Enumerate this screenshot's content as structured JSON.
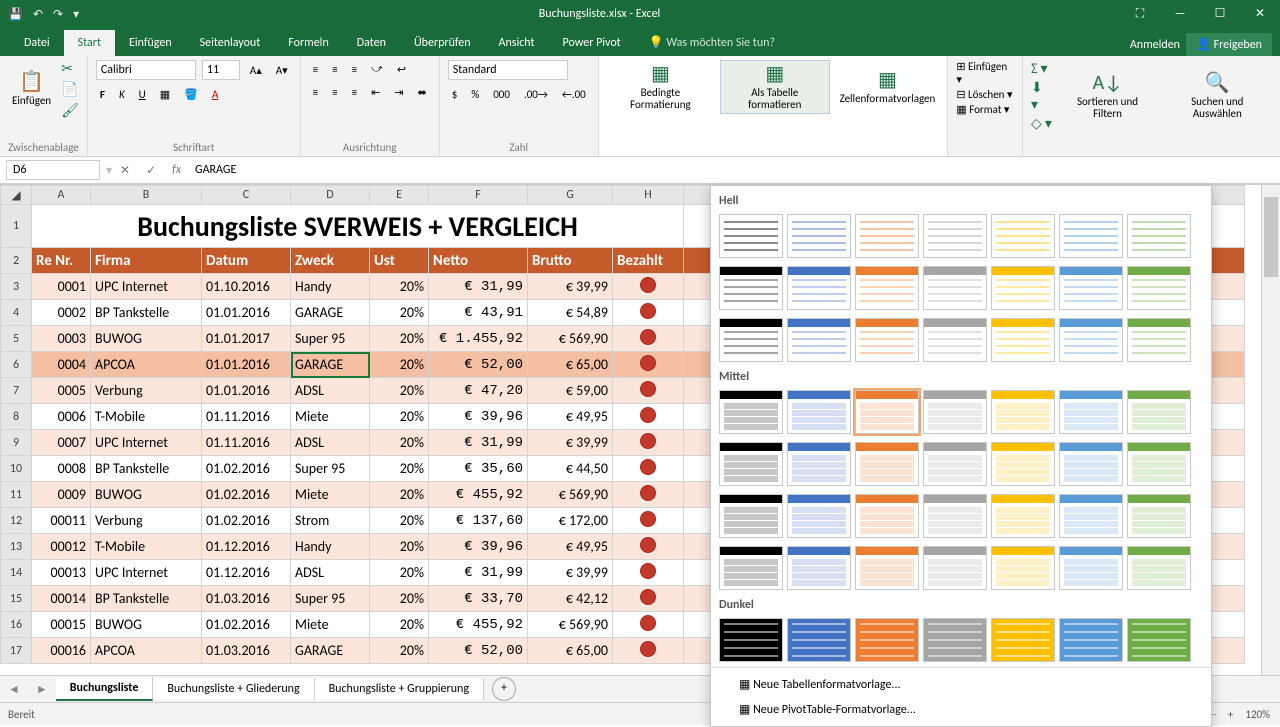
{
  "app": {
    "title": "Buchungsliste.xlsx - Excel",
    "save_icon": "💾",
    "undo": "↶",
    "redo": "↷"
  },
  "win": {
    "opts": "⛶",
    "min": "—",
    "max": "☐",
    "close": "✕"
  },
  "signin": {
    "anmelden": "Anmelden",
    "share": "Freigeben"
  },
  "tabs": {
    "datei": "Datei",
    "start": "Start",
    "einfuegen": "Einfügen",
    "seitenlayout": "Seitenlayout",
    "formeln": "Formeln",
    "daten": "Daten",
    "ueberpruefen": "Überprüfen",
    "ansicht": "Ansicht",
    "powerpivot": "Power Pivot",
    "tellme": "Was möchten Sie tun?"
  },
  "ribbon": {
    "clipboard": {
      "label": "Zwischenablage",
      "paste": "Einfügen"
    },
    "font": {
      "label": "Schriftart",
      "name": "Calibri",
      "size": "11"
    },
    "align": {
      "label": "Ausrichtung"
    },
    "number": {
      "label": "Zahl",
      "format": "Standard"
    },
    "styles": {
      "cond": "Bedingte Formatierung",
      "table": "Als Tabelle formatieren",
      "cell": "Zellenformatvorlagen"
    },
    "cells": {
      "insert": "Einfügen",
      "delete": "Löschen",
      "format": "Format"
    },
    "editing": {
      "sort": "Sortieren und Filtern",
      "find": "Suchen und Auswählen"
    }
  },
  "formula": {
    "cell": "D6",
    "value": "GARAGE"
  },
  "cols": [
    "A",
    "B",
    "C",
    "D",
    "E",
    "F",
    "G",
    "H"
  ],
  "worksheet_title": "Buchungsliste SVERWEIS + VERGLEICH",
  "headers": [
    "Re Nr.",
    "Firma",
    "Datum",
    "Zweck",
    "Ust",
    "Netto",
    "Brutto",
    "Bezahlt"
  ],
  "rows": [
    {
      "n": 3,
      "r": "0001",
      "f": "UPC Internet",
      "d": "01.10.2016",
      "z": "Handy",
      "u": "20%",
      "net": "€      31,99",
      "br": "€ 39,99"
    },
    {
      "n": 4,
      "r": "0002",
      "f": "BP Tankstelle",
      "d": "01.01.2016",
      "z": "GARAGE",
      "u": "20%",
      "net": "€      43,91",
      "br": "€ 54,89"
    },
    {
      "n": 5,
      "r": "0003",
      "f": "BUWOG",
      "d": "01.01.2017",
      "z": "Super 95",
      "u": "20%",
      "net": "€ 1.455,92",
      "br": "€ 569,90"
    },
    {
      "n": 6,
      "r": "0004",
      "f": "APCOA",
      "d": "01.01.2016",
      "z": "GARAGE",
      "u": "20%",
      "net": "€      52,00",
      "br": "€ 65,00",
      "sel": true,
      "hl": true
    },
    {
      "n": 7,
      "r": "0005",
      "f": "Verbung",
      "d": "01.01.2016",
      "z": "ADSL",
      "u": "20%",
      "net": "€      47,20",
      "br": "€ 59,00"
    },
    {
      "n": 8,
      "r": "0006",
      "f": "T-Mobile",
      "d": "01.11.2016",
      "z": "Miete",
      "u": "20%",
      "net": "€      39,96",
      "br": "€ 49,95"
    },
    {
      "n": 9,
      "r": "0007",
      "f": "UPC Internet",
      "d": "01.11.2016",
      "z": "ADSL",
      "u": "20%",
      "net": "€      31,99",
      "br": "€ 39,99"
    },
    {
      "n": 10,
      "r": "0008",
      "f": "BP Tankstelle",
      "d": "01.02.2016",
      "z": "Super 95",
      "u": "20%",
      "net": "€      35,60",
      "br": "€ 44,50"
    },
    {
      "n": 11,
      "r": "0009",
      "f": "BUWOG",
      "d": "01.02.2016",
      "z": "Miete",
      "u": "20%",
      "net": "€    455,92",
      "br": "€ 569,90"
    },
    {
      "n": 12,
      "r": "00011",
      "f": "Verbung",
      "d": "01.02.2016",
      "z": "Strom",
      "u": "20%",
      "net": "€    137,60",
      "br": "€ 172,00"
    },
    {
      "n": 13,
      "r": "00012",
      "f": "T-Mobile",
      "d": "01.12.2016",
      "z": "Handy",
      "u": "20%",
      "net": "€      39,96",
      "br": "€ 49,95"
    },
    {
      "n": 14,
      "r": "00013",
      "f": "UPC Internet",
      "d": "01.12.2016",
      "z": "ADSL",
      "u": "20%",
      "net": "€      31,99",
      "br": "€ 39,99"
    },
    {
      "n": 15,
      "r": "00014",
      "f": "BP Tankstelle",
      "d": "01.03.2016",
      "z": "Super 95",
      "u": "20%",
      "net": "€      33,70",
      "br": "€ 42,12"
    },
    {
      "n": 16,
      "r": "00015",
      "f": "BUWOG",
      "d": "01.02.2016",
      "z": "Miete",
      "u": "20%",
      "net": "€    455,92",
      "br": "€ 569,90"
    },
    {
      "n": 17,
      "r": "00016",
      "f": "APCOA",
      "d": "01.03.2016",
      "z": "GARAGE",
      "u": "20%",
      "net": "€      52,00",
      "br": "€ 65,00"
    }
  ],
  "gallery": {
    "hell": "Hell",
    "mittel": "Mittel",
    "dunkel": "Dunkel",
    "colors": [
      "#000000",
      "#4573c4",
      "#ed7d31",
      "#a5a5a5",
      "#ffc000",
      "#5a9bd5",
      "#70ad47"
    ],
    "new_table": "Neue Tabellenformatvorlage...",
    "new_pivot": "Neue PivotTable-Formatvorlage..."
  },
  "sheets": {
    "s1": "Buchungsliste",
    "s2": "Buchungsliste + Gliederung",
    "s3": "Buchungsliste + Gruppierung"
  },
  "status": {
    "ready": "Bereit",
    "zoom": "120%"
  }
}
